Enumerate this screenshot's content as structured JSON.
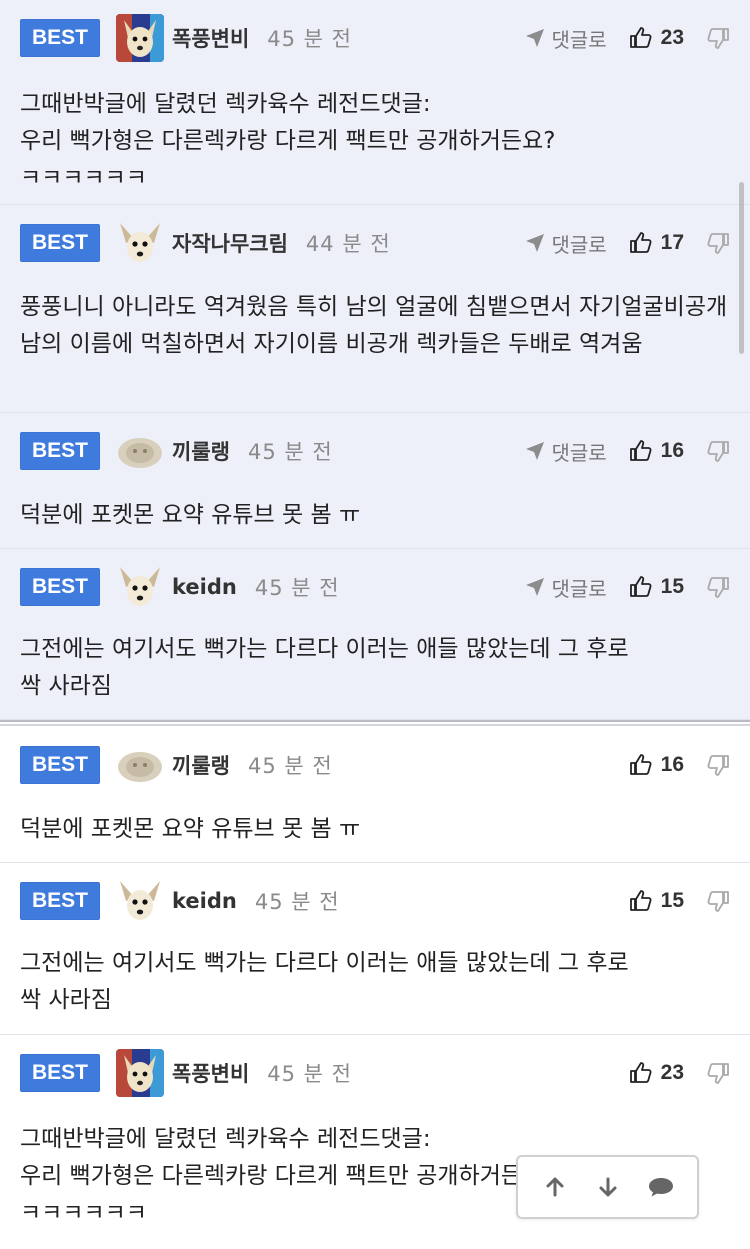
{
  "labels": {
    "best": "BEST",
    "reply": "댓글로"
  },
  "colors": {
    "best_badge": "#3f7bdc",
    "best_background": "#eef0f9",
    "text": "#222222",
    "muted": "#8a8a8a"
  },
  "comments": [
    {
      "nick": "폭풍변비",
      "time": "45 분 전",
      "likes": "23",
      "avatar": "chihuahua-colorful-icon",
      "show_reply": true,
      "text": "그때반박글에 달렸던 렉카육수 레전드댓글:\n우리 뻑가형은 다른렉카랑 다르게 팩트만 공개하거든요?\nㅋㅋㅋㅋㅋㅋ"
    },
    {
      "nick": "자작나무크림",
      "time": "44 분 전",
      "likes": "17",
      "avatar": "chihuahua-icon",
      "show_reply": true,
      "text": "풍풍니니 아니라도 역겨웠음 특히 남의 얼굴에 침뱉으면서 자기얼굴비공개 남의 이름에 먹칠하면서 자기이름 비공개 렉카들은 두배로 역겨움"
    },
    {
      "nick": "끼룰랭",
      "time": "45 분 전",
      "likes": "16",
      "avatar": "blurred-dog-icon",
      "show_reply": true,
      "text": "덕분에 포켓몬 요약 유튜브 못 봄 ㅠ"
    },
    {
      "nick": "keidn",
      "time": "45 분 전",
      "likes": "15",
      "avatar": "chihuahua-icon",
      "show_reply": true,
      "text": "그전에는 여기서도 뻑가는 다르다 이러는 애들 많았는데 그 후로\n싹 사라짐"
    },
    {
      "nick": "끼룰랭",
      "time": "45 분 전",
      "likes": "16",
      "avatar": "blurred-dog-icon",
      "show_reply": false,
      "text": "덕분에 포켓몬 요약 유튜브 못 봄 ㅠ"
    },
    {
      "nick": "keidn",
      "time": "45 분 전",
      "likes": "15",
      "avatar": "chihuahua-icon",
      "show_reply": false,
      "text": "그전에는 여기서도 뻑가는 다르다 이러는 애들 많았는데 그 후로\n싹 사라짐"
    },
    {
      "nick": "폭풍변비",
      "time": "45 분 전",
      "likes": "23",
      "avatar": "chihuahua-colorful-icon",
      "show_reply": false,
      "text": "그때반박글에 달렸던 렉카육수 레전드댓글:\n우리 뻑가형은 다른렉카랑 다르게 팩트만 공개하거든요?\nㅋㅋㅋㅋㅋㅋ"
    }
  ],
  "floating_nav": {
    "icons": [
      "arrow-up-icon",
      "arrow-down-icon",
      "comment-bubble-icon"
    ]
  }
}
